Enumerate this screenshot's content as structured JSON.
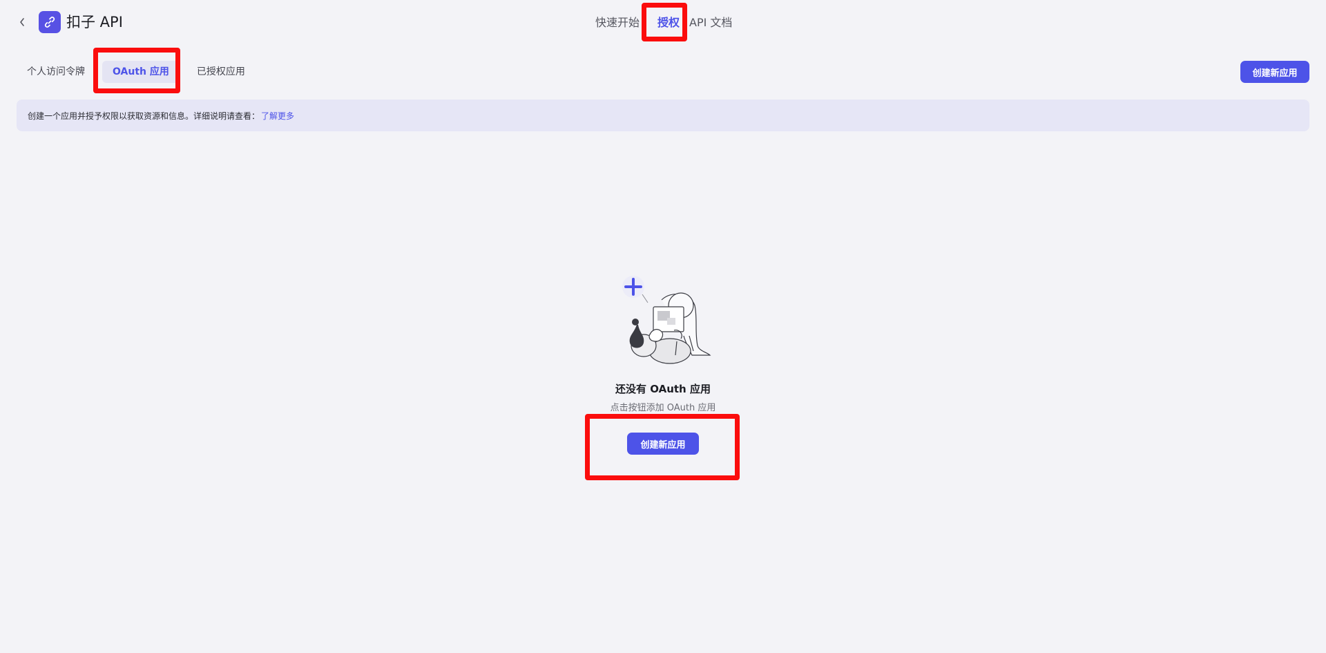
{
  "app": {
    "title": "扣子 API",
    "logo_icon": "link-icon",
    "brand_color": "#4d53e8"
  },
  "top_nav": [
    {
      "label": "快速开始"
    },
    {
      "label": "授权",
      "active": true
    },
    {
      "label": "API 文档"
    }
  ],
  "sub_tabs": [
    {
      "label": "个人访问令牌"
    },
    {
      "label": "OAuth 应用",
      "active": true
    },
    {
      "label": "已授权应用"
    }
  ],
  "actions": {
    "create_label": "创建新应用"
  },
  "info": {
    "text": "创建一个应用并授予权限以获取资源和信息。详细说明请查看：",
    "link": "了解更多"
  },
  "empty": {
    "title": "还没有 OAuth 应用",
    "desc": "点击按钮添加 OAuth 应用",
    "button": "创建新应用",
    "illustration_icon": "empty-illustration"
  },
  "annotation_color": "#fb0d0d"
}
